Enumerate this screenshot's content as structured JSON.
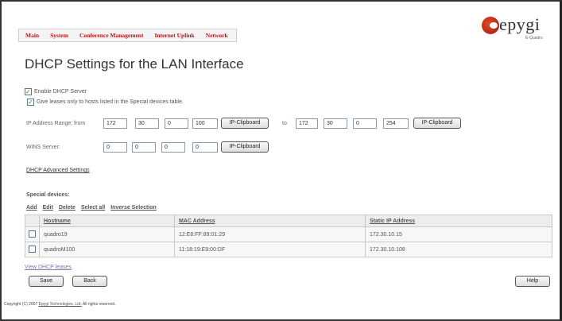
{
  "nav": {
    "items": [
      "Main",
      "System",
      "Conference Management",
      "Internet Uplink",
      "Network"
    ]
  },
  "logo": {
    "text": "epygi",
    "sub": "E-Quadro"
  },
  "page_title": "DHCP Settings for the LAN Interface",
  "enable_dhcp": {
    "label": "Enable DHCP Server",
    "checked": true
  },
  "special_only": {
    "label": "Give leases only to hosts listed in the Special devices table.",
    "checked": true
  },
  "ip_range": {
    "label": "IP Address Range: from",
    "from": [
      "172",
      "30",
      "0",
      "100"
    ],
    "to_label": "to",
    "to": [
      "172",
      "30",
      "0",
      "254"
    ],
    "clipboard_label": "IP-Clipboard"
  },
  "wins": {
    "label": "WINS Server:",
    "octets": [
      "0",
      "0",
      "0",
      "0"
    ],
    "clipboard_label": "IP-Clipboard"
  },
  "advanced_link": "DHCP Advanced Settings",
  "special_devices": {
    "label": "Special devices:",
    "actions": [
      "Add",
      "Edit",
      "Delete",
      "Select all",
      "Inverse Selection"
    ],
    "columns": [
      "Hostname",
      "MAC Address",
      "Static IP Address"
    ],
    "rows": [
      {
        "hostname": "quadro19",
        "mac": "12:E8:FF:89:01:29",
        "ip": "172.30.10.15"
      },
      {
        "hostname": "quadroM100",
        "mac": "11:18:19:E9:00:DF",
        "ip": "172.30.10.108"
      }
    ]
  },
  "view_leases_link": "View DHCP leases",
  "buttons": {
    "save": "Save",
    "back": "Back",
    "help": "Help"
  },
  "footer": {
    "prefix": "Copyright (C) 2007",
    "company": "Epygi Technologies, Ltd.",
    "suffix": "All rights reserved."
  },
  "colors": {
    "nav_text": "#cc1111",
    "accent_check": "#2a8a2a"
  }
}
